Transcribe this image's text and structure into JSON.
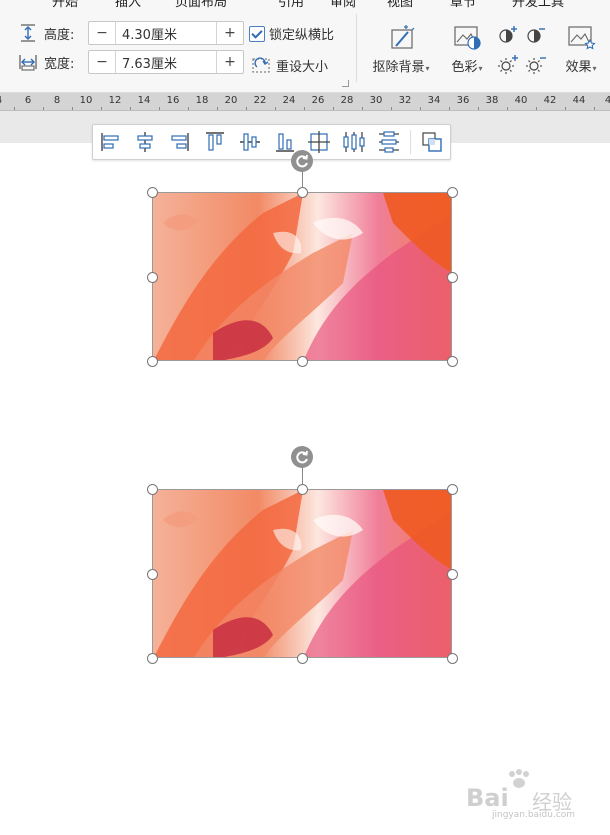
{
  "menu_tabs": [
    "开始",
    "插入",
    "页面布局",
    "引用",
    "审阅",
    "视图",
    "章节",
    "开发工具"
  ],
  "size": {
    "height_label": "高度:",
    "height_value": "4.30厘米",
    "width_label": "宽度:",
    "width_value": "7.63厘米",
    "minus": "−",
    "plus": "+"
  },
  "lock_ratio": {
    "label": "锁定纵横比",
    "checked": true
  },
  "reset_size": {
    "label": "重设大小"
  },
  "tools": {
    "remove_bg": "抠除背景",
    "color": "色彩",
    "effects": "效果"
  },
  "ruler_numbers": [
    "4",
    "6",
    "8",
    "10",
    "12",
    "14",
    "16",
    "18",
    "20",
    "22",
    "24",
    "26",
    "28",
    "30",
    "32",
    "34",
    "36",
    "38",
    "40",
    "42",
    "44",
    "4"
  ],
  "align_tools": [
    "align-left-icon",
    "align-center-icon",
    "align-right-icon",
    "align-top-icon",
    "align-middle-icon",
    "align-bottom-icon",
    "align-page-center-icon",
    "distribute-horizontal-icon",
    "distribute-vertical-icon",
    "group-icon"
  ],
  "watermark": {
    "brand": "Bai",
    "brand_cn": "经验",
    "url": "jingyan.baidu.com"
  },
  "colors": {
    "accent": "#2f6db5",
    "handle_border": "#777777",
    "rotate": "#909090"
  }
}
